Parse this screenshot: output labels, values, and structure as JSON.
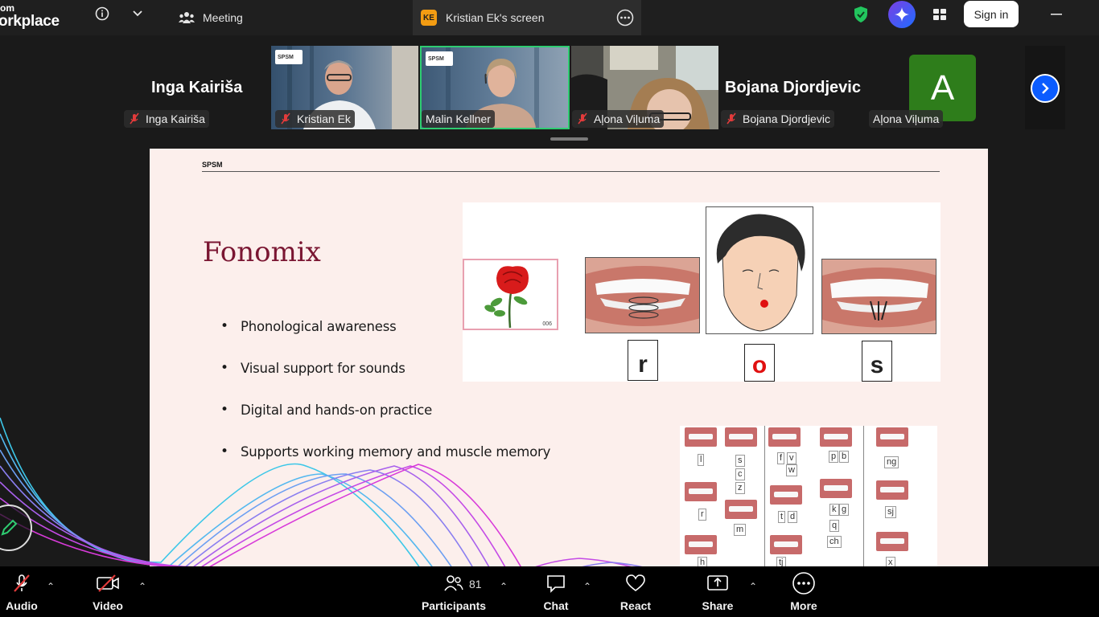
{
  "app": {
    "brand_line1": "om",
    "brand_line2": "orkplace"
  },
  "tabs": [
    {
      "label": "Meeting",
      "icon": "people-icon"
    },
    {
      "label": "Kristian Ek's screen",
      "badge": "KE",
      "icon": "more-icon"
    }
  ],
  "header": {
    "sign_in": "Sign in"
  },
  "participants": {
    "big_names": [
      "Inga Kairiša",
      "Bojana Djordjevic"
    ],
    "tags": [
      "Inga Kairiša",
      "Kristian Ek",
      "Malin Kellner",
      "Aļona Viļuma",
      "Bojana Djordjevic",
      "Aļona Viļuma"
    ],
    "avatar_letter": "A",
    "logo_text": "SPSM"
  },
  "slide": {
    "org": "SPSM",
    "title": "Fonomix",
    "bullets": [
      "Phonological awareness",
      "Visual support for sounds",
      "Digital and hands-on practice",
      "Supports working memory and muscle memory"
    ],
    "card_number": "006",
    "letters": [
      "r",
      "o",
      "s"
    ],
    "chart_letters": [
      "l",
      "s",
      "c",
      "z",
      "f",
      "v",
      "w",
      "p",
      "b",
      "ng",
      "r",
      "m",
      "t",
      "d",
      "k",
      "g",
      "q",
      "ch",
      "sj",
      "h",
      "tj",
      "x"
    ]
  },
  "toolbar": {
    "audio": "Audio",
    "video": "Video",
    "participants": "Participants",
    "participants_count": "81",
    "chat": "Chat",
    "react": "React",
    "share": "Share",
    "more": "More"
  },
  "colors": {
    "accent_blue": "#0b5cff",
    "active_green": "#2ecc71",
    "title_maroon": "#7a1632",
    "mute_red": "#e23b3b"
  }
}
